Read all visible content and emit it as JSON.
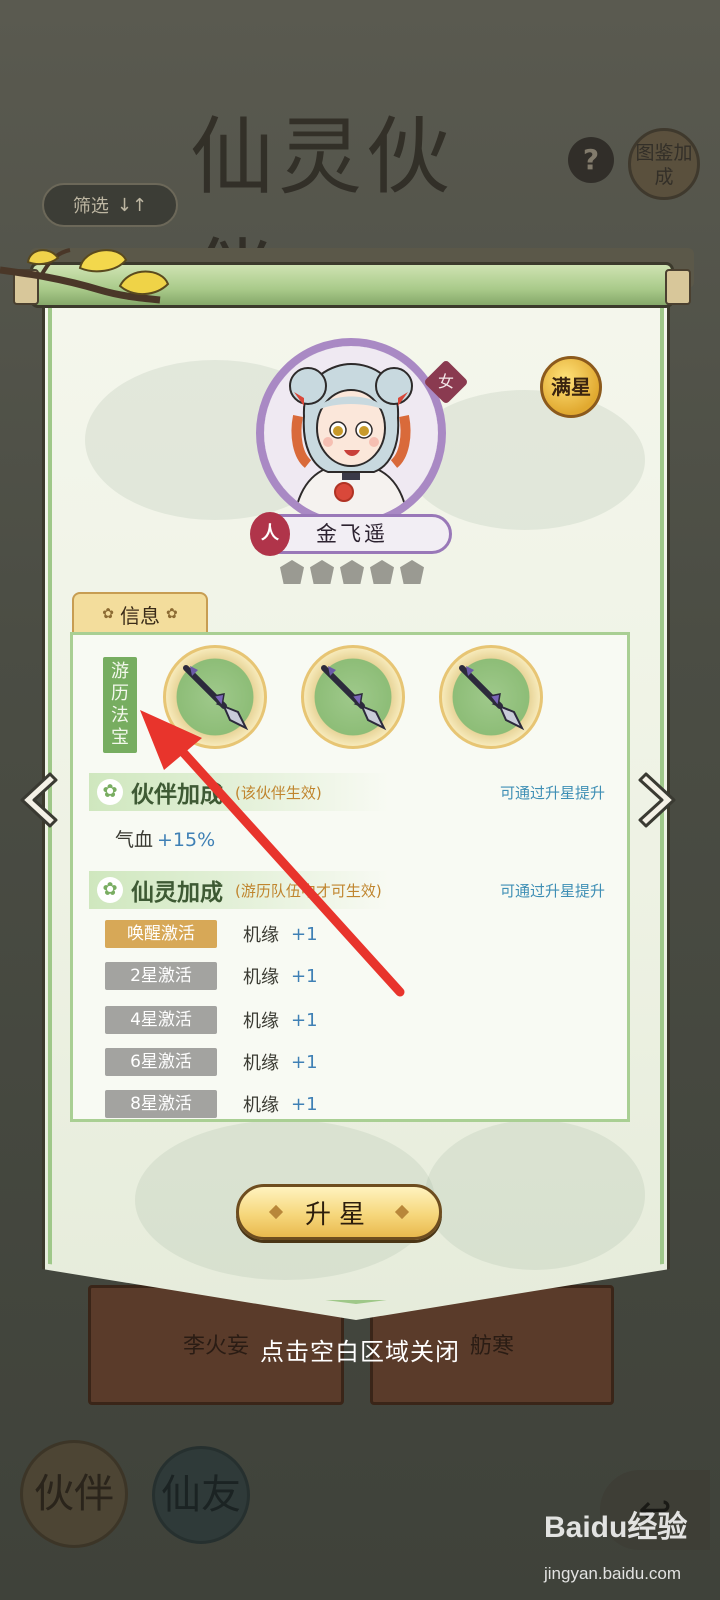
{
  "background": {
    "title": "仙灵伙伴",
    "help_icon": "question-icon",
    "atlas_label": "图鉴加成",
    "filter": {
      "label": "筛选",
      "icon": "sort-icon"
    },
    "cards": [
      {
        "name": "李火妄"
      },
      {
        "name": "舫寒"
      }
    ],
    "tabs": [
      {
        "label": "伙伴"
      },
      {
        "label": "仙友"
      }
    ],
    "back_icon": "back-arrow-icon"
  },
  "partner": {
    "gender": "女",
    "race": "人",
    "name": "金飞遥",
    "max_star_label": "满星",
    "stars_filled": 0,
    "stars_total": 5
  },
  "info_tab": {
    "label": "信息"
  },
  "travel_treasure": {
    "label": "游历法宝",
    "slots": 3
  },
  "partner_bonus": {
    "title": "伙伴加成",
    "note": "(该伙伴生效)",
    "hint": "可通过升星提升",
    "stats": [
      {
        "name": "气血",
        "value": "+15%"
      }
    ]
  },
  "spirit_bonus": {
    "title": "仙灵加成",
    "note": "(游历队伍中才可生效)",
    "hint": "可通过升星提升",
    "rows": [
      {
        "label": "唤醒激活",
        "stat": "机缘",
        "value": "+1",
        "active": true
      },
      {
        "label": "2星激活",
        "stat": "机缘",
        "value": "+1",
        "active": false
      },
      {
        "label": "4星激活",
        "stat": "机缘",
        "value": "+1",
        "active": false
      },
      {
        "label": "6星激活",
        "stat": "机缘",
        "value": "+1",
        "active": false
      },
      {
        "label": "8星激活",
        "stat": "机缘",
        "value": "+1",
        "active": false
      }
    ]
  },
  "upgrade_button": {
    "label": "升星"
  },
  "nav": {
    "prev_icon": "chevron-left-icon",
    "next_icon": "chevron-right-icon"
  },
  "close_hint": "点击空白区域关闭",
  "watermark": {
    "brand": "Baidu经验",
    "url": "jingyan.baidu.com"
  },
  "colors": {
    "accent_green": "#77ad60",
    "accent_gold": "#d7a857",
    "value_blue": "#3f80b5",
    "annotation_red": "#e8342c"
  }
}
